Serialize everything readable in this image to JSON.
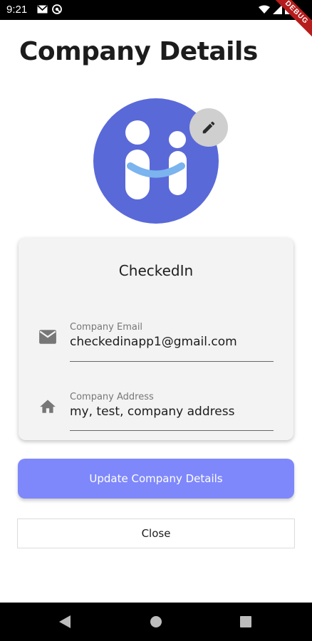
{
  "status_bar": {
    "time": "9:21"
  },
  "debug_banner": "DEBUG",
  "page": {
    "title": "Company Details"
  },
  "company": {
    "name": "CheckedIn",
    "email_label": "Company Email",
    "email_value": "checkedinapp1@gmail.com",
    "address_label": "Company Address",
    "address_value": "my, test, company address"
  },
  "actions": {
    "update_label": "Update Company Details",
    "close_label": "Close"
  },
  "colors": {
    "logo_bg": "#5a69d8",
    "accent": "#7e88fb",
    "card_bg": "#f3f3f3"
  }
}
